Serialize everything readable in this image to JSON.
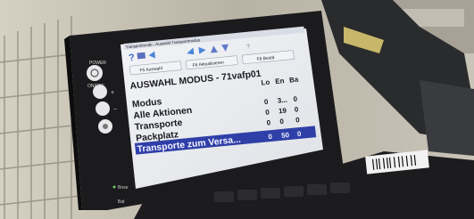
{
  "bezel": {
    "power_label": "POWER",
    "power_sublabel": "ON/OFF",
    "plus_label": "+",
    "minus_label": "−",
    "bottom_labels": [
      "Bose",
      "Bat"
    ]
  },
  "screen": {
    "title_bar": "Transportmode - Auswahl Transportmodus",
    "toolbar_help": "?",
    "buttons": [
      "F5 Auswahl",
      "F6 Aktualisieren",
      "F8 Bestä"
    ],
    "heading": "AUSWAHL MODUS - 71vafp01",
    "columns": [
      "Lo",
      "En",
      "Ba"
    ],
    "rows": [
      {
        "label": "Modus",
        "values": [
          "",
          "",
          ""
        ]
      },
      {
        "label": "Alle Aktionen",
        "values": [
          "0",
          "3...",
          "0"
        ]
      },
      {
        "label": "Transporte",
        "values": [
          "0",
          "19",
          "0"
        ]
      },
      {
        "label": "Packplatz",
        "values": [
          "0",
          "0",
          "0"
        ]
      },
      {
        "label": "Transporte zum Versa...",
        "values": [
          "0",
          "50",
          "0"
        ],
        "selected": true
      }
    ]
  },
  "colors": {
    "selection": "#2f3fa8",
    "screen_bg": "#eceef2",
    "bezel": "#1b1b1d"
  }
}
